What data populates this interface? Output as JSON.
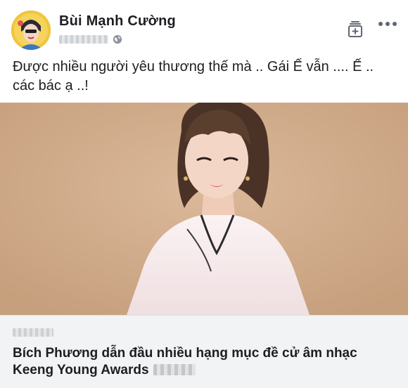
{
  "post": {
    "author": "Bùi Mạnh Cường",
    "text": "Được nhiều người yêu thương thế mà .. Gái Ế vẫn .... Ế .. các bác ạ ..!",
    "privacy_icon": "globe-icon",
    "save_icon": "save-collection-icon",
    "more_icon": "more-options-icon"
  },
  "link_preview": {
    "title": "Bích Phương dẫn đầu nhiều hạng mục đề cử âm nhạc Keeng Young Awards"
  },
  "colors": {
    "photo_background": "#d2ad8c",
    "preview_background": "#f2f3f5",
    "text": "#1c1e21"
  }
}
